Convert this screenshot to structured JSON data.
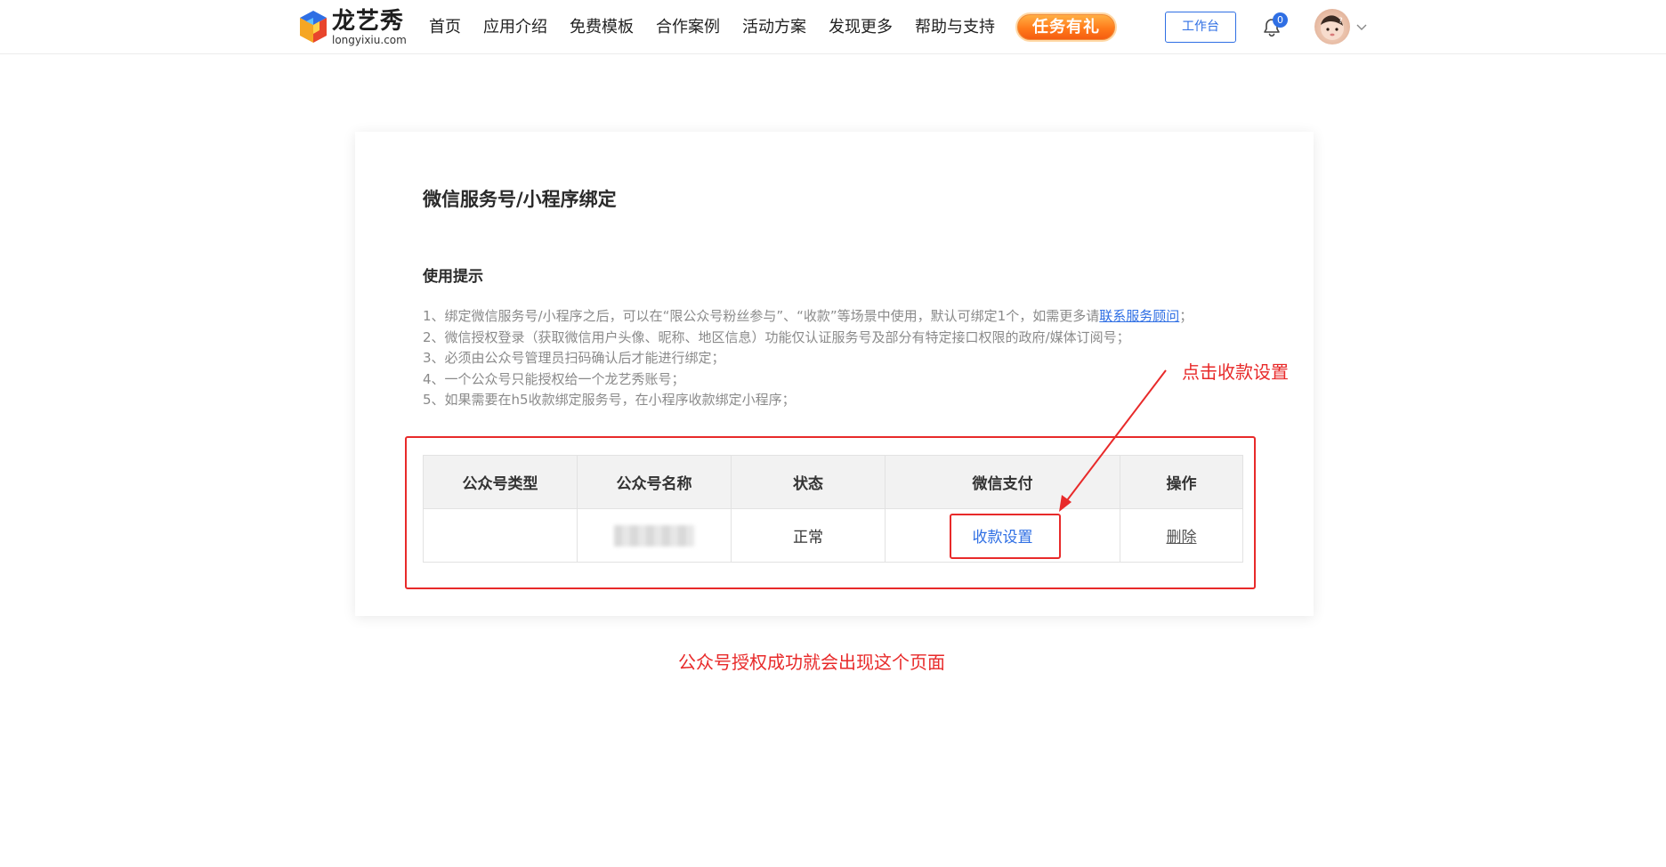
{
  "brand": {
    "name": "龙艺秀",
    "domain": "longyixiu.com"
  },
  "nav": {
    "items": [
      {
        "label": "首页"
      },
      {
        "label": "应用介绍"
      },
      {
        "label": "免费模板"
      },
      {
        "label": "合作案例"
      },
      {
        "label": "活动方案"
      },
      {
        "label": "发现更多"
      },
      {
        "label": "帮助与支持"
      }
    ],
    "promo_label": "任务有礼",
    "workbench_label": "工作台",
    "notification_count": "0"
  },
  "page": {
    "title": "微信服务号/小程序绑定",
    "tips_title": "使用提示",
    "tips": [
      {
        "text": "1、绑定微信服务号/小程序之后，可以在“限公众号粉丝参与”、“收款”等场景中使用，默认可绑定1个，如需更多请",
        "link": "联系服务顾问",
        "suffix": "；"
      },
      {
        "text": "2、微信授权登录（获取微信用户头像、昵称、地区信息）功能仅认证服务号及部分有特定接口权限的政府/媒体订阅号；"
      },
      {
        "text": "3、必须由公众号管理员扫码确认后才能进行绑定；"
      },
      {
        "text": "4、一个公众号只能授权给一个龙艺秀账号；"
      },
      {
        "text": "5、如果需要在h5收款绑定服务号，在小程序收款绑定小程序；"
      }
    ]
  },
  "table": {
    "headers": [
      "公众号类型",
      "公众号名称",
      "状态",
      "微信支付",
      "操作"
    ],
    "rows": [
      {
        "type": "",
        "name_blurred": true,
        "status": "正常",
        "pay_action": "收款设置",
        "op_action": "删除"
      }
    ]
  },
  "annotations": {
    "hint_click": "点击收款设置",
    "hint_success": "公众号授权成功就会出现这个页面",
    "color": "#e82a2a"
  },
  "colors": {
    "accent": "#2f6fe4",
    "promo": "#ff7a1a"
  }
}
